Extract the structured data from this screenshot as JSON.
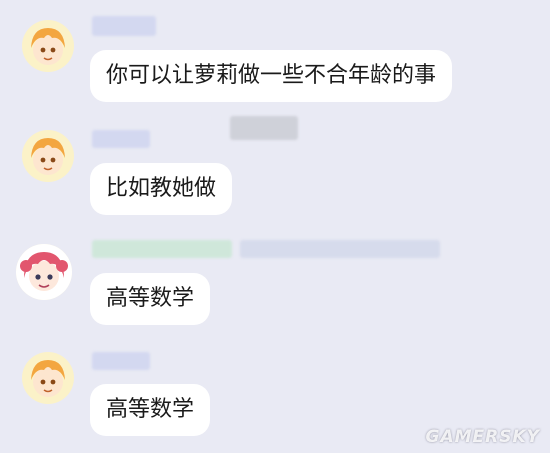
{
  "messages": [
    {
      "sender": "orange-hair-user",
      "text": "你可以让萝莉做一些不合年龄的事"
    },
    {
      "sender": "orange-hair-user",
      "text": "比如教她做"
    },
    {
      "sender": "pink-hair-user",
      "text": "高等数学"
    },
    {
      "sender": "orange-hair-user",
      "text": "高等数学"
    }
  ],
  "watermark": "GAMERSKY",
  "colors": {
    "background": "#e9eaf4",
    "bubble": "#ffffff",
    "orange_hair": "#f3a640",
    "pink_hair": "#e2566e"
  }
}
